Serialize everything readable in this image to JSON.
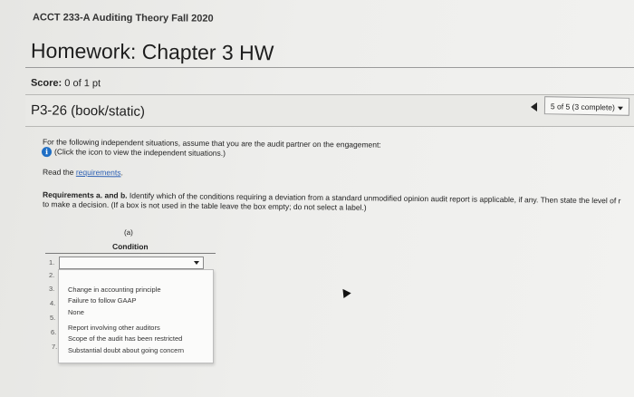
{
  "course_title": "ACCT 233-A Auditing Theory Fall 2020",
  "homework_title": "Homework: Chapter 3 HW",
  "score": {
    "label": "Score:",
    "value": "0 of 1 pt"
  },
  "problem": {
    "title": "P3-26 (book/static)"
  },
  "navigation": {
    "progress_text": "5 of 5 (3 complete)",
    "prev_icon": "triangle-left-icon",
    "menu_icon": "caret-down-icon"
  },
  "instructions": {
    "intro": "For the following independent situations, assume that you are the audit partner on the engagement:",
    "info_text": "(Click the icon to view the independent situations.)",
    "info_icon": "info-icon",
    "read_prefix": "Read the",
    "requirements_link": "requirements",
    "read_suffix": "."
  },
  "requirements": {
    "bold_part": "Requirements a. and b.",
    "line1_rest": " Identify which of the conditions requiring a deviation from a standard unmodified opinion audit report is applicable, if any. Then state the level of r",
    "line2": "to make a decision. (If a box is not used in the table leave the box empty; do not select a label.)"
  },
  "table": {
    "column_letter": "(a)",
    "column_header": "Condition",
    "row_numbers": [
      "1.",
      "2.",
      "3.",
      "4.",
      "5.",
      "6.",
      "7."
    ]
  },
  "dropdown_options": [
    "Change in accounting principle",
    "Failure to follow GAAP",
    "None",
    "Report involving other auditors",
    "Scope of the audit has been restricted",
    "Substantial doubt about going concern"
  ],
  "colors": {
    "accent_blue": "#1f6fc5",
    "link_blue": "#2b5fb3"
  }
}
